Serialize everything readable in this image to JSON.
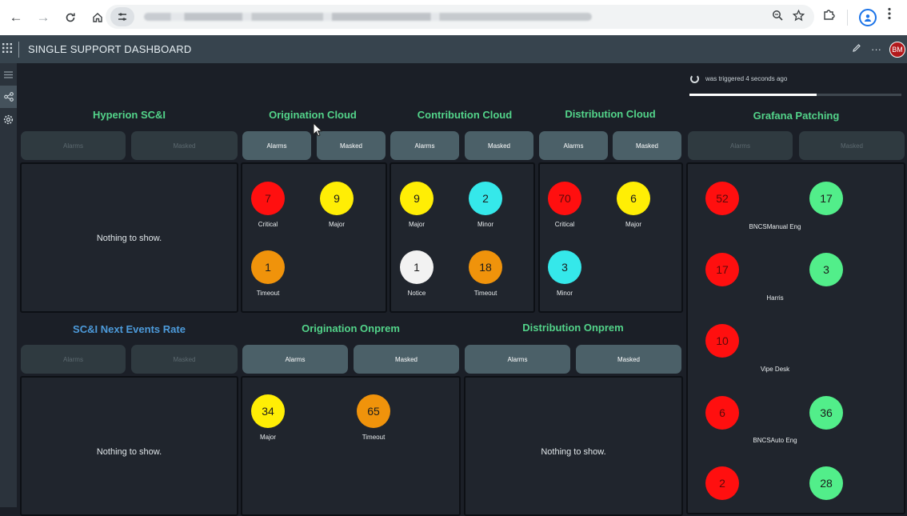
{
  "browser": {
    "nav": {
      "back": "←",
      "forward": "→",
      "reload": "C",
      "home": "⌂"
    },
    "icons": {
      "tune": "tune-icon",
      "zoom": "zoom-icon",
      "star": "star-icon",
      "extension": "puzzle-icon",
      "profile": "profile-icon",
      "menu": "kebab-icon"
    }
  },
  "header": {
    "title": "SINGLE SUPPORT DASHBOARD",
    "avatar": "BM",
    "more": "···"
  },
  "status": {
    "text": "was triggered 4 seconds ago",
    "progress": 0.6
  },
  "panels": {
    "hyperion": {
      "title": "Hyperion SC&I",
      "alarms": "Alarms",
      "masked": "Masked",
      "empty": "Nothing to show."
    },
    "origination_cloud": {
      "title": "Origination Cloud",
      "alarms": "Alarms",
      "masked": "Masked",
      "items": [
        {
          "value": "7",
          "label": "Critical"
        },
        {
          "value": "9",
          "label": "Major"
        },
        {
          "value": "1",
          "label": "Timeout"
        }
      ]
    },
    "contribution_cloud": {
      "title": "Contribution Cloud",
      "alarms": "Alarms",
      "masked": "Masked",
      "items": [
        {
          "value": "9",
          "label": "Major"
        },
        {
          "value": "2",
          "label": "Minor"
        },
        {
          "value": "1",
          "label": "Notice"
        },
        {
          "value": "18",
          "label": "Timeout"
        }
      ]
    },
    "distribution_cloud": {
      "title": "Distribution Cloud",
      "alarms": "Alarms",
      "masked": "Masked",
      "items": [
        {
          "value": "70",
          "label": "Critical"
        },
        {
          "value": "6",
          "label": "Major"
        },
        {
          "value": "3",
          "label": "Minor"
        }
      ]
    },
    "grafana": {
      "title": "Grafana Patching",
      "alarms": "Alarms",
      "masked": "Masked",
      "groups": [
        {
          "red": "52",
          "green": "17",
          "label": "BNCSManual Eng"
        },
        {
          "red": "17",
          "green": "3",
          "label": "Harris"
        },
        {
          "red": "10",
          "green": "",
          "label": "Vipe Desk"
        },
        {
          "red": "6",
          "green": "36",
          "label": "BNCSAuto Eng"
        },
        {
          "red": "2",
          "green": "28",
          "label": ""
        }
      ]
    },
    "events_rate": {
      "title": "SC&I Next Events Rate",
      "alarms": "Alarms",
      "masked": "Masked",
      "empty": "Nothing to show."
    },
    "origination_onprem": {
      "title": "Origination Onprem",
      "alarms": "Alarms",
      "masked": "Masked",
      "items": [
        {
          "value": "34",
          "label": "Major"
        },
        {
          "value": "65",
          "label": "Timeout"
        }
      ]
    },
    "distribution_onprem": {
      "title": "Distribution Onprem",
      "alarms": "Alarms",
      "masked": "Masked",
      "empty": "Nothing to show."
    }
  },
  "colors": {
    "critical": "#ff0f0f",
    "major": "#ffee05",
    "timeout": "#f0930b",
    "minor": "#35e8ea",
    "notice": "#f2f2f2",
    "ok": "#52ee8a"
  }
}
